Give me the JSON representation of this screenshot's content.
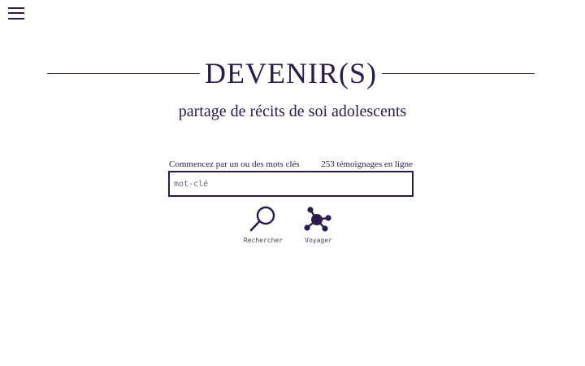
{
  "header": {
    "menu_icon": "hamburger-menu-icon"
  },
  "hero": {
    "title": "DEVENIR(S)",
    "subtitle": "partage de récits de soi adolescents"
  },
  "search": {
    "hint": "Commencez par un ou des mots clés",
    "count_text": "253 témoignages en ligne",
    "placeholder": "mot-clé",
    "value": ""
  },
  "actions": {
    "search_label": "Rechercher",
    "search_icon": "magnifier-icon",
    "voyage_label": "Voyager",
    "voyage_icon": "network-nodes-icon"
  },
  "colors": {
    "primary": "#2b1a4a",
    "background": "#ffffff"
  }
}
